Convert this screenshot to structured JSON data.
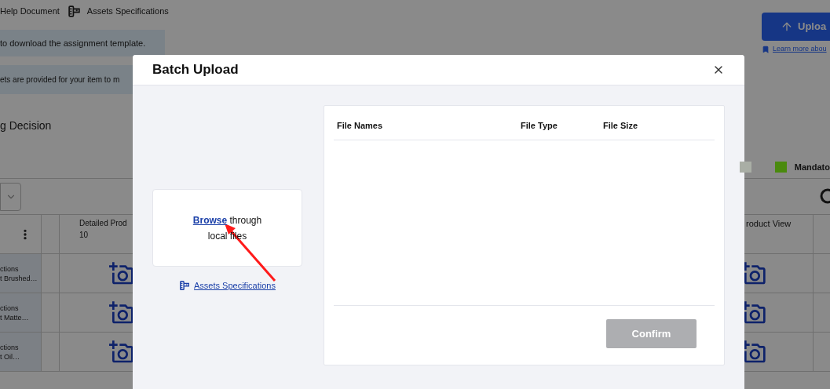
{
  "top_links": [
    {
      "label": "Help Document"
    },
    {
      "label": "Assets Specifications"
    }
  ],
  "banners": [
    "to download the assignment template.",
    "ets are provided for your item to m"
  ],
  "section_title": "g Decision",
  "upload_button": "Uploa",
  "learn_more_link": "Learn more abou",
  "legend": [
    {
      "color": "#a9aea5"
    },
    {
      "label": "Mandato",
      "color": "#4a8a0e"
    }
  ],
  "table": {
    "columns": [
      {
        "label": "Detailed Prod",
        "count": "10"
      },
      {
        "label": "roduct View"
      }
    ],
    "rows": [
      {
        "line_1": "ctions",
        "line_2": "t Brushed…"
      },
      {
        "line_1": "ctions",
        "line_2": "t Matte…"
      },
      {
        "line_1": "ctions",
        "line_2": "t Oil…"
      }
    ]
  },
  "modal": {
    "title": "Batch Upload",
    "dropzone": {
      "link": "Browse",
      "text": "through local files"
    },
    "specs_link": "Assets Specifications",
    "file_table": {
      "columns": [
        "File Names",
        "File Type",
        "File Size"
      ]
    },
    "confirm": {
      "label": "Confirm",
      "disabled": true
    }
  }
}
